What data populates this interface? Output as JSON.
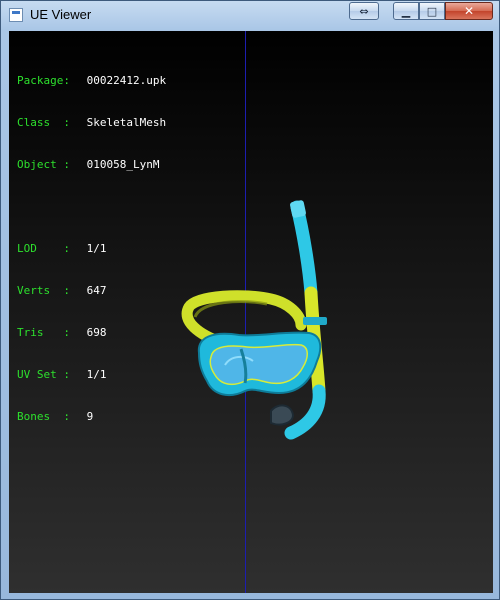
{
  "window": {
    "title": "UE Viewer",
    "buttons": {
      "swap": "⇔",
      "minimize": "▁",
      "maximize": "□",
      "close": "✕"
    }
  },
  "info": {
    "package": {
      "label": "Package:",
      "value": "00022412.upk"
    },
    "class": {
      "label": "Class  :",
      "value": "SkeletalMesh"
    },
    "object": {
      "label": "Object :",
      "value": "010058_LynM"
    },
    "lod": {
      "label": "LOD    :",
      "value": "1/1"
    },
    "verts": {
      "label": "Verts  :",
      "value": "647"
    },
    "tris": {
      "label": "Tris   :",
      "value": "698"
    },
    "uvset": {
      "label": "UV Set :",
      "value": "1/1"
    },
    "bones": {
      "label": "Bones  :",
      "value": "9"
    }
  },
  "colors": {
    "label_green": "#2de02d",
    "value_white": "#ffffff",
    "axis_blue": "#1d1db0",
    "mesh_cyan": "#2ec8e6",
    "mesh_yellow": "#d8e62a"
  }
}
